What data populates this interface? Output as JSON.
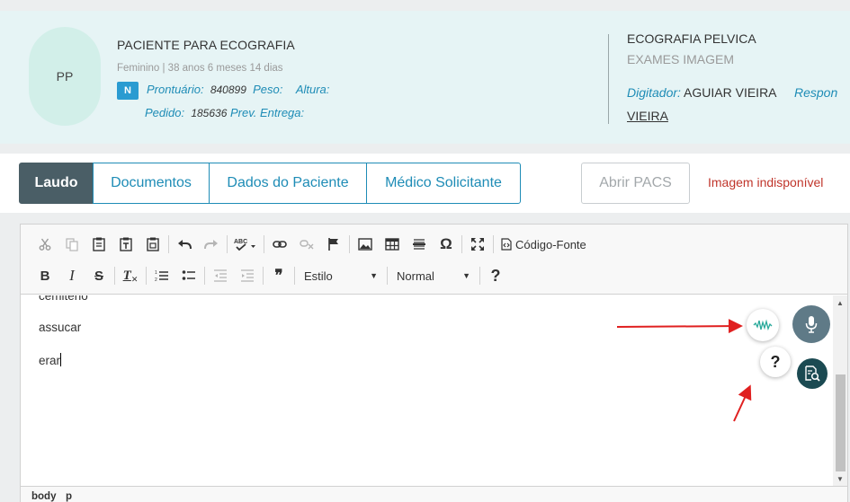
{
  "patient": {
    "initials": "PP",
    "name": "PACIENTE PARA ECOGRAFIA",
    "info": "Feminino | 38 anos 6 meses 14 dias",
    "badge": "N",
    "prontuario_label": "Prontuário:",
    "prontuario_value": "840899",
    "peso_label": "Peso:",
    "altura_label": "Altura:",
    "pedido_label": "Pedido:",
    "pedido_value": "185636",
    "prev_entrega_label": "Prev. Entrega:"
  },
  "exam": {
    "title": "ECOGRAFIA PELVICA",
    "subtitle": "EXAMES IMAGEM",
    "digitador_label": "Digitador:",
    "digitador_value": "AGUIAR VIEIRA",
    "responsavel_label": "Respon",
    "responsavel_value": "VIEIRA"
  },
  "tabs": [
    {
      "label": "Laudo",
      "active": true
    },
    {
      "label": "Documentos",
      "active": false
    },
    {
      "label": "Dados do Paciente",
      "active": false
    },
    {
      "label": "Médico Solicitante",
      "active": false
    }
  ],
  "pacs_button": "Abrir PACS",
  "image_status": "Imagem indisponível",
  "toolbar": {
    "source_label": "Código-Fonte",
    "style_combo": "Estilo",
    "format_combo": "Normal",
    "help": "?",
    "bold": "B",
    "italic": "I",
    "strike": "S",
    "removeformat": "T",
    "quote": "99",
    "omega": "Ω"
  },
  "editor_lines": [
    "cemitério",
    "assucar",
    "erar"
  ],
  "statusbar": {
    "path1": "body",
    "path2": "p"
  },
  "floating": {
    "help": "?"
  },
  "colors": {
    "accent": "#1e8cb6",
    "active_tab": "#4a5e66",
    "error": "#c0352b",
    "mic_button": "#5f7a87",
    "doc_button": "#1b4a52",
    "arrow": "#e02020"
  }
}
